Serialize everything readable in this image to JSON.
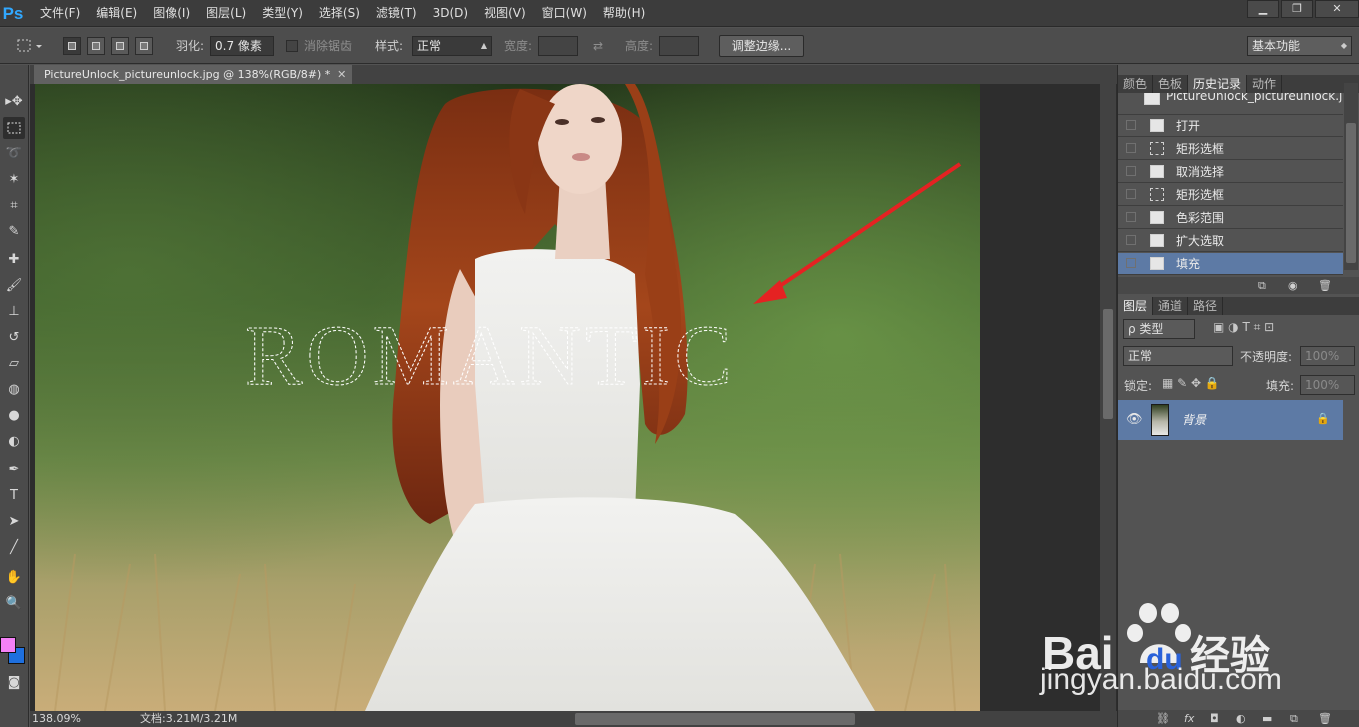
{
  "app": {
    "logo": "Ps"
  },
  "menu": [
    "文件(F)",
    "编辑(E)",
    "图像(I)",
    "图层(L)",
    "类型(Y)",
    "选择(S)",
    "滤镜(T)",
    "3D(D)",
    "视图(V)",
    "窗口(W)",
    "帮助(H)"
  ],
  "window": {
    "minimize": "▁",
    "restore": "❐",
    "close": "✕"
  },
  "options": {
    "feather_label": "羽化:",
    "feather_value": "0.7 像素",
    "antialias_label": "消除锯齿",
    "style_label": "样式:",
    "style_value": "正常",
    "width_label": "宽度:",
    "height_label": "高度:",
    "refine_button": "调整边缘...",
    "workspace": "基本功能"
  },
  "document": {
    "tab_title": "PictureUnlock_pictureunlock.jpg @ 138%(RGB/8#) *",
    "close": "✕",
    "selection_text": "ROMANTIC",
    "zoom": "138.09%",
    "doc_size": "文档:3.21M/3.21M"
  },
  "colors": {
    "foreground": "#f481f6",
    "background": "#1e6fde",
    "accent_arrow": "#e52222",
    "selection_highlight": "#5d7aa5"
  },
  "panels": {
    "top_tabs": [
      "颜色",
      "色板",
      "历史记录",
      "动作"
    ],
    "active_top_tab": "历史记录",
    "history_snapshot": "PictureUnlock_pictureunlock.jpg",
    "history": [
      {
        "label": "打开",
        "icon": "doc"
      },
      {
        "label": "矩形选框",
        "icon": "marq"
      },
      {
        "label": "取消选择",
        "icon": "doc"
      },
      {
        "label": "矩形选框",
        "icon": "marq"
      },
      {
        "label": "色彩范围",
        "icon": "doc"
      },
      {
        "label": "扩大选取",
        "icon": "doc"
      },
      {
        "label": "填充",
        "icon": "doc"
      }
    ],
    "layer_tabs": [
      "图层",
      "通道",
      "路径"
    ],
    "layer_filter": "ρ 类型",
    "blend_mode": "正常",
    "opacity_label": "不透明度:",
    "opacity_value": "100%",
    "lock_label": "锁定:",
    "fill_label": "填充:",
    "fill_value": "100%",
    "layer_name": "背景"
  },
  "watermark": {
    "brand": "Bai",
    "brand_suffix": "du",
    "brand_cn": "经验",
    "site": "jingyan.baidu.com"
  }
}
